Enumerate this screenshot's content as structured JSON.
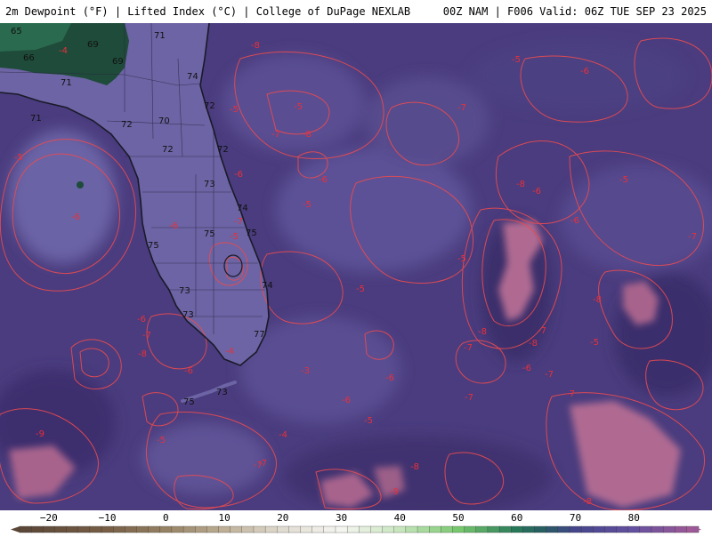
{
  "header": {
    "title_left": "2m Dewpoint (°F) | Lifted Index (°C) | College of DuPage NEXLAB",
    "title_right": "00Z NAM | F006 Valid: 06Z TUE SEP 23 2025"
  },
  "map": {
    "dewpoint_labels": [
      "65",
      "66",
      "69",
      "69",
      "66",
      "71",
      "71",
      "71",
      "74",
      "72",
      "72",
      "70",
      "72",
      "72",
      "73",
      "74",
      "75",
      "75",
      "75",
      "74",
      "73",
      "73",
      "73",
      "77",
      "75"
    ],
    "lifted_index_labels": [
      "-4",
      "-5",
      "-6",
      "-5",
      "-8",
      "-5",
      "-6",
      "-5",
      "-7",
      "-8",
      "-6",
      "-7",
      "-5",
      "-7",
      "-5",
      "-5",
      "-5",
      "-6",
      "-5",
      "-6",
      "-8",
      "-6",
      "-8",
      "-7",
      "-8",
      "-7",
      "-7",
      "-5",
      "-6",
      "-8",
      "-8",
      "-9",
      "-6",
      "-8",
      "-7",
      "-6",
      "-4",
      "-5",
      "-7",
      "-8",
      "-7",
      "-5",
      "-3",
      "-6",
      "-9",
      "-7",
      "-7",
      "-6",
      "-4",
      "-7",
      "-6"
    ],
    "colors": {
      "ocean_base": "#4a3c7e",
      "ocean_light": "#5a4d92",
      "ocean_dark": "#3a2d6a",
      "land": "#6e66a6",
      "land_humid": "#1f4b3a",
      "contour": "#ea4b50",
      "coast": "#1a1a28"
    }
  },
  "colorbar": {
    "unit": "°F",
    "tick_labels": [
      "−20",
      "−10",
      "0",
      "10",
      "20",
      "30",
      "40",
      "50",
      "60",
      "70",
      "80"
    ],
    "tick_values": [
      -20,
      -10,
      0,
      10,
      20,
      30,
      40,
      50,
      60,
      70,
      80
    ],
    "range": [
      -25,
      90
    ]
  }
}
